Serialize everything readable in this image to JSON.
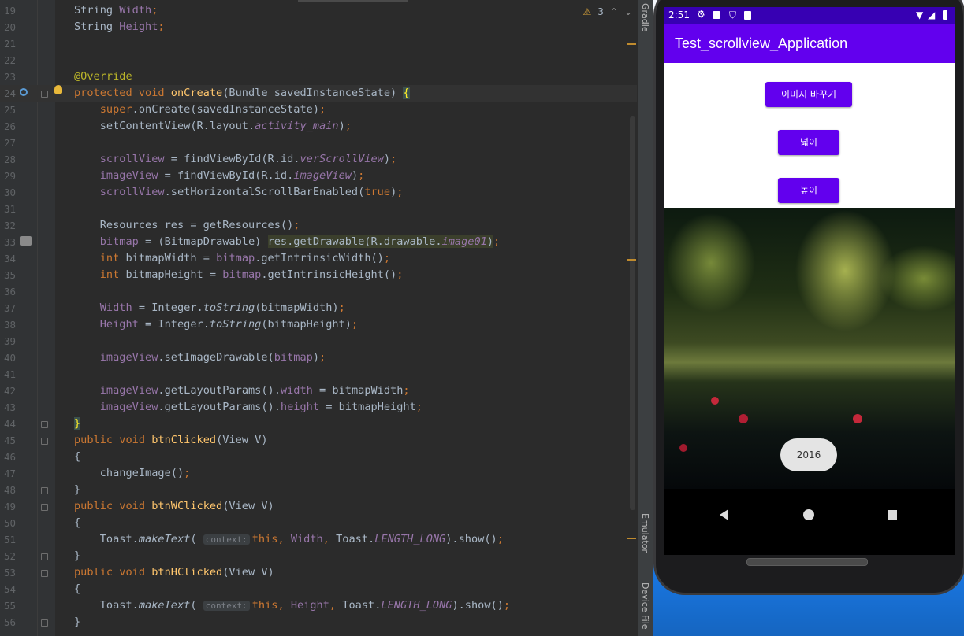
{
  "editor": {
    "inspection": {
      "warnings": "3"
    },
    "lines": [
      {
        "n": "19",
        "tokens": [
          {
            "t": "String "
          },
          {
            "t": "Width",
            "c": "field"
          },
          {
            "t": ";",
            "c": "kw"
          }
        ]
      },
      {
        "n": "20",
        "tokens": [
          {
            "t": "String "
          },
          {
            "t": "Height",
            "c": "field"
          },
          {
            "t": ";",
            "c": "kw"
          }
        ]
      },
      {
        "n": "21",
        "tokens": []
      },
      {
        "n": "22",
        "tokens": []
      },
      {
        "n": "23",
        "tokens": [
          {
            "t": "@Override",
            "c": "ann"
          }
        ]
      },
      {
        "n": "24",
        "current": true,
        "tokens": [
          {
            "t": "protected void ",
            "c": "kw"
          },
          {
            "t": "onCreate",
            "c": "fn"
          },
          {
            "t": "(Bundle savedInstanceState) "
          },
          {
            "t": "{",
            "c": "brace"
          }
        ]
      },
      {
        "n": "25",
        "tokens": [
          {
            "t": "    "
          },
          {
            "t": "super",
            "c": "kw"
          },
          {
            "t": ".onCreate(savedInstanceState)"
          },
          {
            "t": ";",
            "c": "kw"
          }
        ]
      },
      {
        "n": "26",
        "tokens": [
          {
            "t": "    setContentView(R.layout."
          },
          {
            "t": "activity_main",
            "c": "static"
          },
          {
            "t": ")"
          },
          {
            "t": ";",
            "c": "kw"
          }
        ]
      },
      {
        "n": "27",
        "tokens": []
      },
      {
        "n": "28",
        "tokens": [
          {
            "t": "    "
          },
          {
            "t": "scrollView",
            "c": "field"
          },
          {
            "t": " = findViewById(R.id."
          },
          {
            "t": "verScrollView",
            "c": "static"
          },
          {
            "t": ")"
          },
          {
            "t": ";",
            "c": "kw"
          }
        ]
      },
      {
        "n": "29",
        "tokens": [
          {
            "t": "    "
          },
          {
            "t": "imageView",
            "c": "field"
          },
          {
            "t": " = findViewById(R.id."
          },
          {
            "t": "imageView",
            "c": "static"
          },
          {
            "t": ")"
          },
          {
            "t": ";",
            "c": "kw"
          }
        ]
      },
      {
        "n": "30",
        "tokens": [
          {
            "t": "    "
          },
          {
            "t": "scrollView",
            "c": "field"
          },
          {
            "t": ".setHorizontalScrollBarEnabled("
          },
          {
            "t": "true",
            "c": "kw"
          },
          {
            "t": ")"
          },
          {
            "t": ";",
            "c": "kw"
          }
        ]
      },
      {
        "n": "31",
        "tokens": []
      },
      {
        "n": "32",
        "tokens": [
          {
            "t": "    Resources res = getResources()"
          },
          {
            "t": ";",
            "c": "kw"
          }
        ]
      },
      {
        "n": "33",
        "tokens": [
          {
            "t": "    "
          },
          {
            "t": "bitmap",
            "c": "field"
          },
          {
            "t": " = (BitmapDrawable) "
          },
          {
            "t": "res.getDrawable(R.drawable.",
            "c": "hl"
          },
          {
            "t": "image01",
            "c": "static-hl"
          },
          {
            "t": ")",
            "c": "hl"
          },
          {
            "t": ";",
            "c": "kw"
          }
        ]
      },
      {
        "n": "34",
        "tokens": [
          {
            "t": "    "
          },
          {
            "t": "int ",
            "c": "kw"
          },
          {
            "t": "bitmapWidth = "
          },
          {
            "t": "bitmap",
            "c": "field"
          },
          {
            "t": ".getIntrinsicWidth()"
          },
          {
            "t": ";",
            "c": "kw"
          }
        ]
      },
      {
        "n": "35",
        "tokens": [
          {
            "t": "    "
          },
          {
            "t": "int ",
            "c": "kw"
          },
          {
            "t": "bitmapHeight = "
          },
          {
            "t": "bitmap",
            "c": "field"
          },
          {
            "t": ".getIntrinsicHeight()"
          },
          {
            "t": ";",
            "c": "kw"
          }
        ]
      },
      {
        "n": "36",
        "tokens": []
      },
      {
        "n": "37",
        "tokens": [
          {
            "t": "    "
          },
          {
            "t": "Width",
            "c": "field"
          },
          {
            "t": " = Integer."
          },
          {
            "t": "toString",
            "c": "italic"
          },
          {
            "t": "(bitmapWidth)"
          },
          {
            "t": ";",
            "c": "kw"
          }
        ]
      },
      {
        "n": "38",
        "tokens": [
          {
            "t": "    "
          },
          {
            "t": "Height",
            "c": "field"
          },
          {
            "t": " = Integer."
          },
          {
            "t": "toString",
            "c": "italic"
          },
          {
            "t": "(bitmapHeight)"
          },
          {
            "t": ";",
            "c": "kw"
          }
        ]
      },
      {
        "n": "39",
        "tokens": []
      },
      {
        "n": "40",
        "tokens": [
          {
            "t": "    "
          },
          {
            "t": "imageView",
            "c": "field"
          },
          {
            "t": ".setImageDrawable("
          },
          {
            "t": "bitmap",
            "c": "field"
          },
          {
            "t": ")"
          },
          {
            "t": ";",
            "c": "kw"
          }
        ]
      },
      {
        "n": "41",
        "tokens": []
      },
      {
        "n": "42",
        "tokens": [
          {
            "t": "    "
          },
          {
            "t": "imageView",
            "c": "field"
          },
          {
            "t": ".getLayoutParams()."
          },
          {
            "t": "width",
            "c": "field"
          },
          {
            "t": " = bitmapWidth"
          },
          {
            "t": ";",
            "c": "kw"
          }
        ]
      },
      {
        "n": "43",
        "tokens": [
          {
            "t": "    "
          },
          {
            "t": "imageView",
            "c": "field"
          },
          {
            "t": ".getLayoutParams()."
          },
          {
            "t": "height",
            "c": "field"
          },
          {
            "t": " = bitmapHeight"
          },
          {
            "t": ";",
            "c": "kw"
          }
        ]
      },
      {
        "n": "44",
        "tokens": [
          {
            "t": "}",
            "c": "brace"
          }
        ]
      },
      {
        "n": "45",
        "tokens": [
          {
            "t": "public void ",
            "c": "kw"
          },
          {
            "t": "btnClicked",
            "c": "fn"
          },
          {
            "t": "(View V)"
          }
        ]
      },
      {
        "n": "46",
        "tokens": [
          {
            "t": "{"
          }
        ]
      },
      {
        "n": "47",
        "tokens": [
          {
            "t": "    changeImage()"
          },
          {
            "t": ";",
            "c": "kw"
          }
        ]
      },
      {
        "n": "48",
        "tokens": [
          {
            "t": "}"
          }
        ]
      },
      {
        "n": "49",
        "tokens": [
          {
            "t": "public void ",
            "c": "kw"
          },
          {
            "t": "btnWClicked",
            "c": "fn"
          },
          {
            "t": "(View V)"
          }
        ]
      },
      {
        "n": "50",
        "tokens": [
          {
            "t": "{"
          }
        ]
      },
      {
        "n": "51",
        "tokens": [
          {
            "t": "    Toast."
          },
          {
            "t": "makeText",
            "c": "italic"
          },
          {
            "t": "( "
          },
          {
            "t": "context:",
            "c": "hint"
          },
          {
            "t": "this",
            "c": "kw"
          },
          {
            "t": ", ",
            "c": "kw"
          },
          {
            "t": "Width",
            "c": "field"
          },
          {
            "t": ", ",
            "c": "kw"
          },
          {
            "t": "Toast."
          },
          {
            "t": "LENGTH_LONG",
            "c": "static"
          },
          {
            "t": ").show()"
          },
          {
            "t": ";",
            "c": "kw"
          }
        ]
      },
      {
        "n": "52",
        "tokens": [
          {
            "t": "}"
          }
        ]
      },
      {
        "n": "53",
        "tokens": [
          {
            "t": "public void ",
            "c": "kw"
          },
          {
            "t": "btnHClicked",
            "c": "fn"
          },
          {
            "t": "(View V)"
          }
        ]
      },
      {
        "n": "54",
        "tokens": [
          {
            "t": "{"
          }
        ]
      },
      {
        "n": "55",
        "tokens": [
          {
            "t": "    Toast."
          },
          {
            "t": "makeText",
            "c": "italic"
          },
          {
            "t": "( "
          },
          {
            "t": "context:",
            "c": "hint"
          },
          {
            "t": "this",
            "c": "kw"
          },
          {
            "t": ", ",
            "c": "kw"
          },
          {
            "t": "Height",
            "c": "field"
          },
          {
            "t": ", ",
            "c": "kw"
          },
          {
            "t": "Toast."
          },
          {
            "t": "LENGTH_LONG",
            "c": "static"
          },
          {
            "t": ").show()"
          },
          {
            "t": ";",
            "c": "kw"
          }
        ]
      },
      {
        "n": "56",
        "tokens": [
          {
            "t": "}"
          }
        ]
      }
    ]
  },
  "tool_windows": {
    "gradle": "Gradle",
    "emulator": "Emulator",
    "device_file": "Device File"
  },
  "emulator": {
    "status_time": "2:51",
    "app_title": "Test_scrollview_Application",
    "buttons": {
      "change_image": "이미지 바꾸기",
      "width": "넓이",
      "height": "높이"
    },
    "toast": "2016"
  },
  "colors": {
    "app_bar": "#6200ee",
    "status_bar": "#3700b3",
    "editor_bg": "#2b2b2b",
    "keyword": "#cc7832",
    "function": "#ffc66d",
    "field": "#9876aa"
  }
}
